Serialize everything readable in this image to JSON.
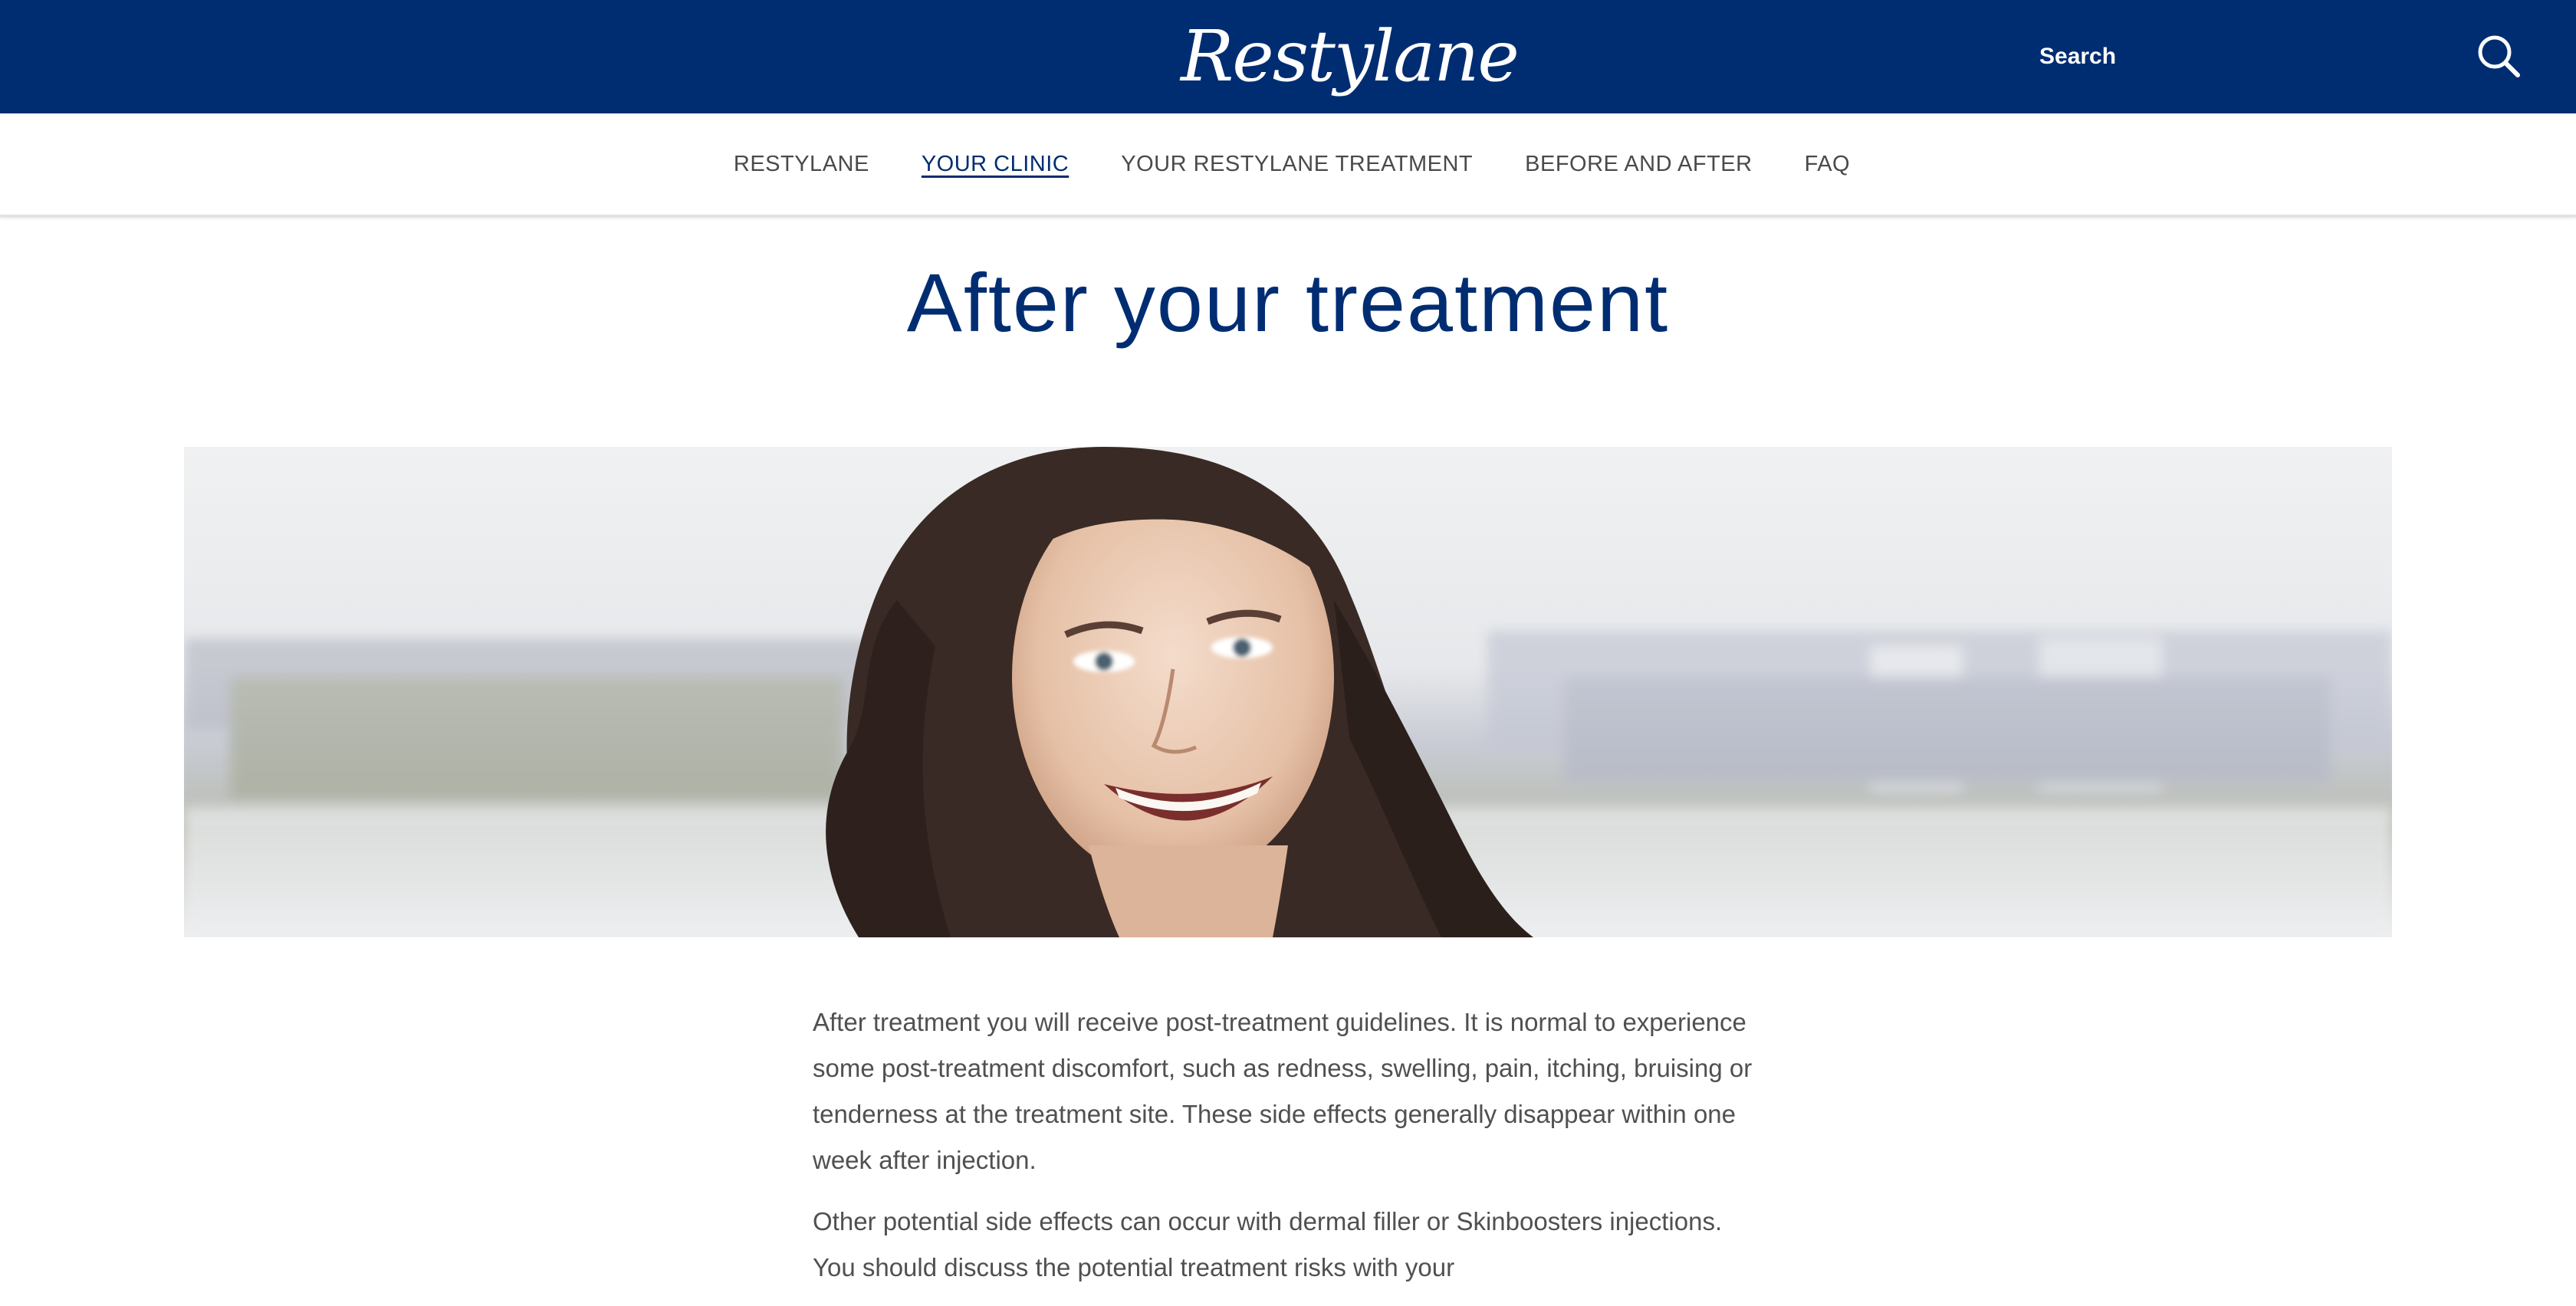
{
  "header": {
    "logo_text": "Restylane",
    "search_label": "Search",
    "search_icon": "search-icon",
    "background_color": "#002d72"
  },
  "nav": {
    "items": [
      {
        "label": "RESTYLANE",
        "active": false
      },
      {
        "label": "YOUR CLINIC",
        "active": true
      },
      {
        "label": "YOUR RESTYLANE TREATMENT",
        "active": false
      },
      {
        "label": "BEFORE AND AFTER",
        "active": false
      },
      {
        "label": "FAQ",
        "active": false
      }
    ]
  },
  "main": {
    "title": "After your treatment",
    "paragraphs": [
      "After treatment you will receive post-treatment guidelines. It is normal to experience some post-treatment discomfort, such as redness, swelling, pain, itching, bruising or tenderness at the treatment site. These side effects generally disappear within one week after injection.",
      "Other potential side effects can occur with dermal filler or Skinboosters injections. You should discuss the potential treatment risks with your"
    ]
  },
  "colors": {
    "brand_blue": "#002d72",
    "text_gray": "#505050",
    "nav_gray": "#4a4a4a"
  }
}
